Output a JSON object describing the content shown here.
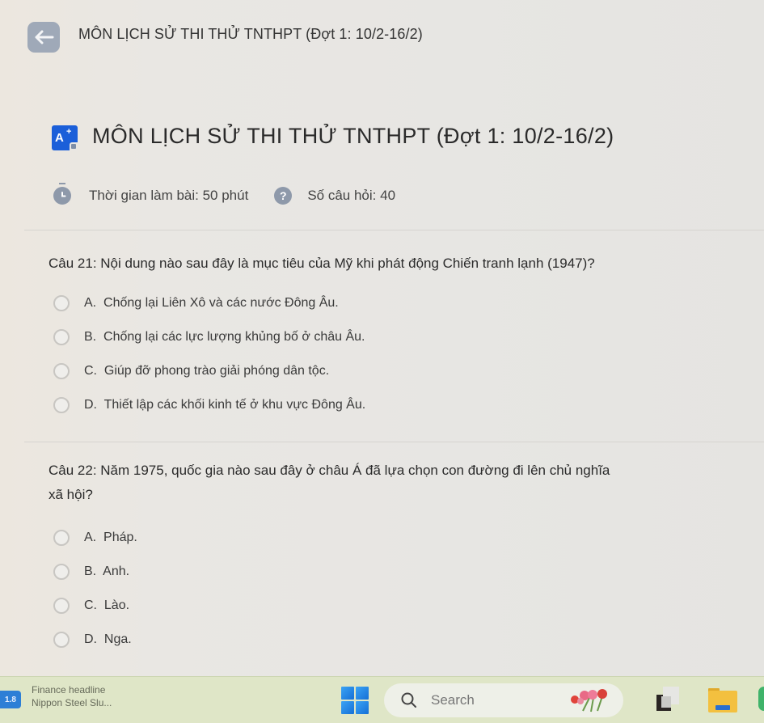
{
  "topbar": {
    "back_label": "Back",
    "title": "MÔN LỊCH SỬ THI THỬ TNTHPT (Đợt 1: 10/2-16/2)"
  },
  "exam": {
    "icon_text": "A",
    "icon_plus": "+",
    "title": "MÔN LỊCH SỬ THI THỬ TNTHPT (Đợt 1: 10/2-16/2)",
    "duration_label": "Thời gian làm bài: 50 phút",
    "question_count_label": "Số câu hỏi: 40",
    "help_glyph": "?"
  },
  "questions": [
    {
      "number_label": "Câu 21:",
      "text": "Nội dung nào sau đây là mục tiêu của Mỹ khi phát động Chiến tranh lạnh (1947)?",
      "text_line2": "",
      "options": [
        {
          "letter": "A.",
          "text": "Chống lại Liên Xô và các nước Đông Âu."
        },
        {
          "letter": "B.",
          "text": "Chống lại các lực lượng khủng bố ở châu Âu."
        },
        {
          "letter": "C.",
          "text": "Giúp đỡ phong trào giải phóng dân tộc."
        },
        {
          "letter": "D.",
          "text": "Thiết lập các khối kinh tế ở khu vực Đông Âu."
        }
      ]
    },
    {
      "number_label": "Câu 22:",
      "text": "Năm 1975, quốc gia nào sau đây ở châu Á đã lựa chọn con đường đi lên chủ nghĩa",
      "text_line2": "xã hội?",
      "options": [
        {
          "letter": "A.",
          "text": "Pháp."
        },
        {
          "letter": "B.",
          "text": "Anh."
        },
        {
          "letter": "C.",
          "text": "Lào."
        },
        {
          "letter": "D.",
          "text": "Nga."
        }
      ]
    }
  ],
  "taskbar": {
    "news_icon_text": "1.8",
    "news_title": "Finance headline",
    "news_subtitle": "Nippon Steel Slu...",
    "search_placeholder": "Search"
  },
  "colors": {
    "back_button": "#9fa9b8",
    "exam_icon": "#1b5fd9",
    "meta_icon": "#8e99aa",
    "taskbar": "#dfe6c7",
    "start_blue": "#1f86e6"
  }
}
